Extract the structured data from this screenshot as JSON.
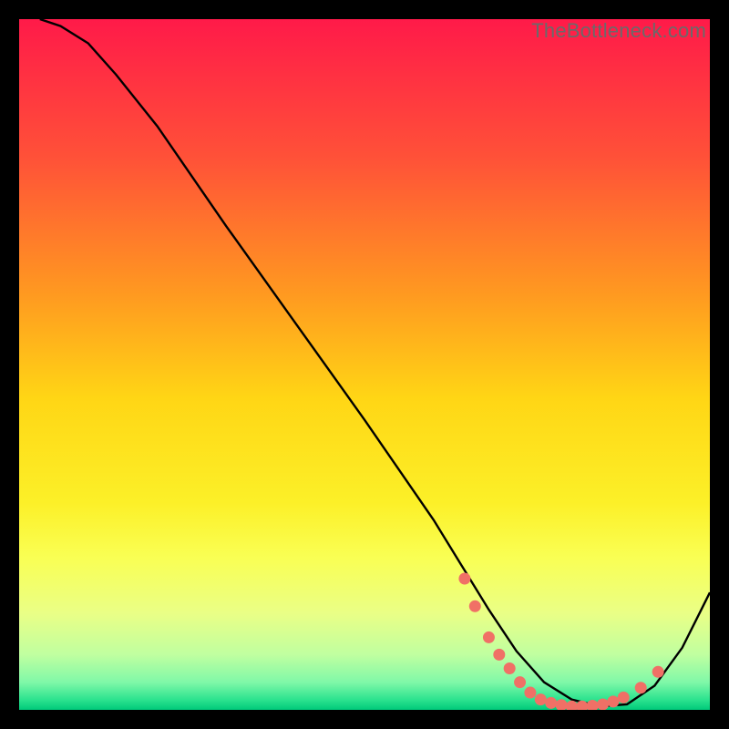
{
  "watermark": "TheBottleneck.com",
  "chart_data": {
    "type": "line",
    "title": "",
    "xlabel": "",
    "ylabel": "",
    "xlim": [
      0,
      100
    ],
    "ylim": [
      0,
      100
    ],
    "grid": false,
    "legend": false,
    "background_gradient": {
      "stops": [
        {
          "offset": 0.0,
          "color": "#ff1a49"
        },
        {
          "offset": 0.2,
          "color": "#ff5138"
        },
        {
          "offset": 0.4,
          "color": "#ff9a20"
        },
        {
          "offset": 0.55,
          "color": "#ffd615"
        },
        {
          "offset": 0.7,
          "color": "#fcf028"
        },
        {
          "offset": 0.78,
          "color": "#f9ff54"
        },
        {
          "offset": 0.86,
          "color": "#eaff86"
        },
        {
          "offset": 0.92,
          "color": "#c0ffa0"
        },
        {
          "offset": 0.96,
          "color": "#80f8a8"
        },
        {
          "offset": 0.985,
          "color": "#2de38f"
        },
        {
          "offset": 1.0,
          "color": "#00c97a"
        }
      ]
    },
    "series": [
      {
        "name": "curve",
        "color": "#000000",
        "x": [
          3,
          6,
          10,
          14,
          20,
          30,
          40,
          50,
          60,
          64,
          68,
          72,
          76,
          80,
          84,
          88,
          92,
          96,
          100
        ],
        "y": [
          100,
          99,
          96.5,
          92,
          84.5,
          70,
          56,
          42,
          27.5,
          21,
          14.5,
          8.5,
          4,
          1.5,
          0.5,
          0.8,
          3.5,
          9,
          17
        ]
      }
    ],
    "markers": {
      "name": "dots",
      "color": "#f07066",
      "x": [
        64.5,
        66,
        68,
        69.5,
        71,
        72.5,
        74,
        75.5,
        77,
        78.5,
        80,
        81.5,
        83,
        84.5,
        86,
        87.5,
        90,
        92.5
      ],
      "y": [
        19,
        15,
        10.5,
        8,
        6,
        4,
        2.5,
        1.5,
        1,
        0.7,
        0.5,
        0.5,
        0.6,
        0.8,
        1.2,
        1.8,
        3.2,
        5.5
      ]
    }
  }
}
